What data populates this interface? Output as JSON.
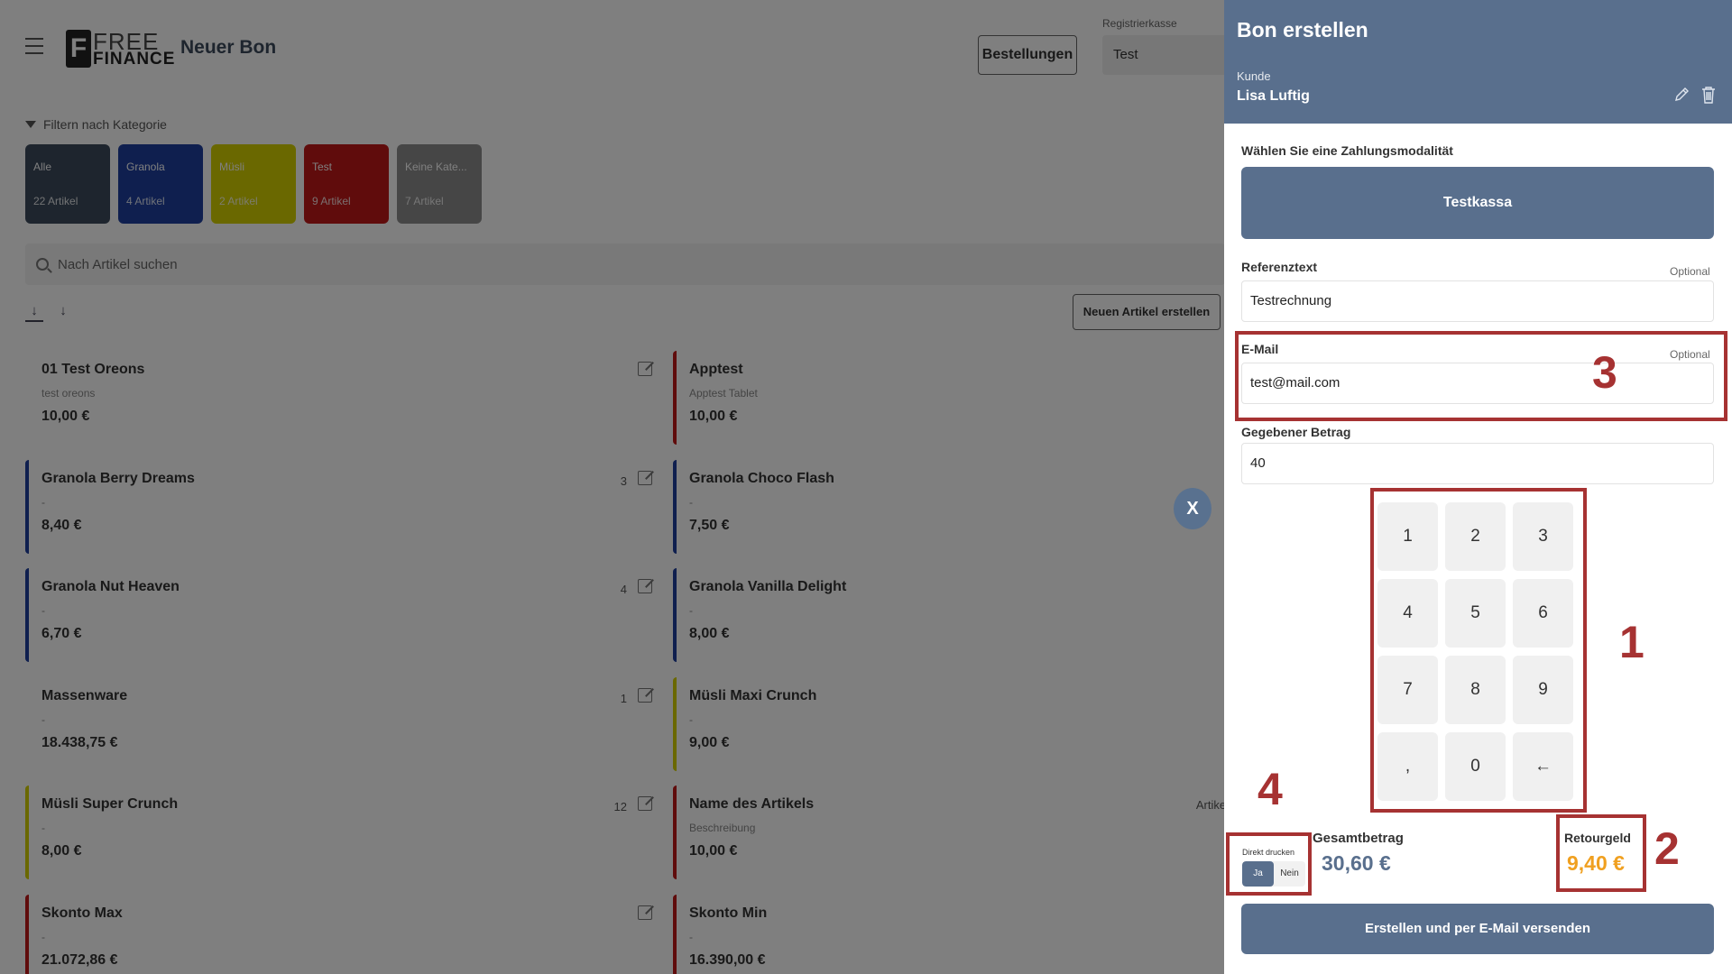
{
  "header": {
    "page_title": "Neuer Bon",
    "logo_free": "FREE",
    "logo_finance": "FINANCE",
    "orders_button": "Bestellungen",
    "register_label": "Registrierkasse",
    "register_value": "Test"
  },
  "filter": {
    "toggle_label": "Filtern nach Kategorie",
    "categories": [
      {
        "name": "Alle",
        "count": "22 Artikel",
        "color": "#3c4a5c"
      },
      {
        "name": "Granola",
        "count": "4 Artikel",
        "color": "#1e3f9e"
      },
      {
        "name": "Müsli",
        "count": "2 Artikel",
        "color": "#d4d000"
      },
      {
        "name": "Test",
        "count": "9 Artikel",
        "color": "#c01818"
      },
      {
        "name": "Keine Kate...",
        "count": "7 Artikel",
        "color": "#8c8c8c"
      }
    ]
  },
  "search": {
    "placeholder": "Nach Artikel suchen"
  },
  "new_article_button": "Neuen Artikel erstellen",
  "articles": [
    {
      "name": "01 Test Oreons",
      "desc": "test oreons",
      "price": "10,00 €",
      "stock": "",
      "color": ""
    },
    {
      "name": "Apptest",
      "desc": "Apptest Tablet",
      "price": "10,00 €",
      "stock": "",
      "color": "#c01818"
    },
    {
      "name": "Granola Berry Dreams",
      "desc": "-",
      "price": "8,40 €",
      "stock": "3",
      "color": "#1e3f9e"
    },
    {
      "name": "Granola Choco Flash",
      "desc": "-",
      "price": "7,50 €",
      "stock": "",
      "color": "#1e3f9e"
    },
    {
      "name": "Granola Nut Heaven",
      "desc": "-",
      "price": "6,70 €",
      "stock": "4",
      "color": "#1e3f9e"
    },
    {
      "name": "Granola Vanilla Delight",
      "desc": "-",
      "price": "8,00 €",
      "stock": "",
      "color": "#1e3f9e"
    },
    {
      "name": "Massenware",
      "desc": "-",
      "price": "18.438,75 €",
      "stock": "1",
      "color": ""
    },
    {
      "name": "Müsli Maxi Crunch",
      "desc": "-",
      "price": "9,00 €",
      "stock": "",
      "color": "#d4d000"
    },
    {
      "name": "Müsli Super Crunch",
      "desc": "-",
      "price": "8,00 €",
      "stock": "12",
      "color": "#d4d000"
    },
    {
      "name": "Name des Artikels",
      "desc": "Beschreibung",
      "price": "10,00 €",
      "stock": "",
      "color": "#c01818",
      "extra": "Artikel"
    },
    {
      "name": "Skonto Max",
      "desc": "-",
      "price": "21.072,86 €",
      "stock": "",
      "color": "#c01818"
    },
    {
      "name": "Skonto Min",
      "desc": "-",
      "price": "16.390,00 €",
      "stock": "",
      "color": "#c01818"
    }
  ],
  "close_button": "X",
  "dialog": {
    "title": "Bon erstellen",
    "customer_label": "Kunde",
    "customer_name": "Lisa Luftig",
    "payment_label": "Wählen Sie eine Zahlungsmodalität",
    "payment_option": "Testkassa",
    "reference_label": "Referenztext",
    "reference_optional": "Optional",
    "reference_value": "Testrechnung",
    "email_label": "E-Mail",
    "email_optional": "Optional",
    "email_value": "test@mail.com",
    "given_label": "Gegebener Betrag",
    "given_value": "40",
    "keys": [
      "1",
      "2",
      "3",
      "4",
      "5",
      "6",
      "7",
      "8",
      "9",
      ",",
      "0",
      "←"
    ],
    "print_label": "Direkt drucken",
    "print_yes": "Ja",
    "print_no": "Nein",
    "total_label": "Gesamtbetrag",
    "total_value": "30,60 €",
    "change_label": "Retourgeld",
    "change_value": "9,40 €",
    "submit_button": "Erstellen und per E-Mail versenden"
  },
  "annotations": [
    "1",
    "2",
    "3",
    "4"
  ],
  "colors": {
    "accent": "#596f8d",
    "annotation": "#a63232",
    "change": "#f0a020"
  }
}
